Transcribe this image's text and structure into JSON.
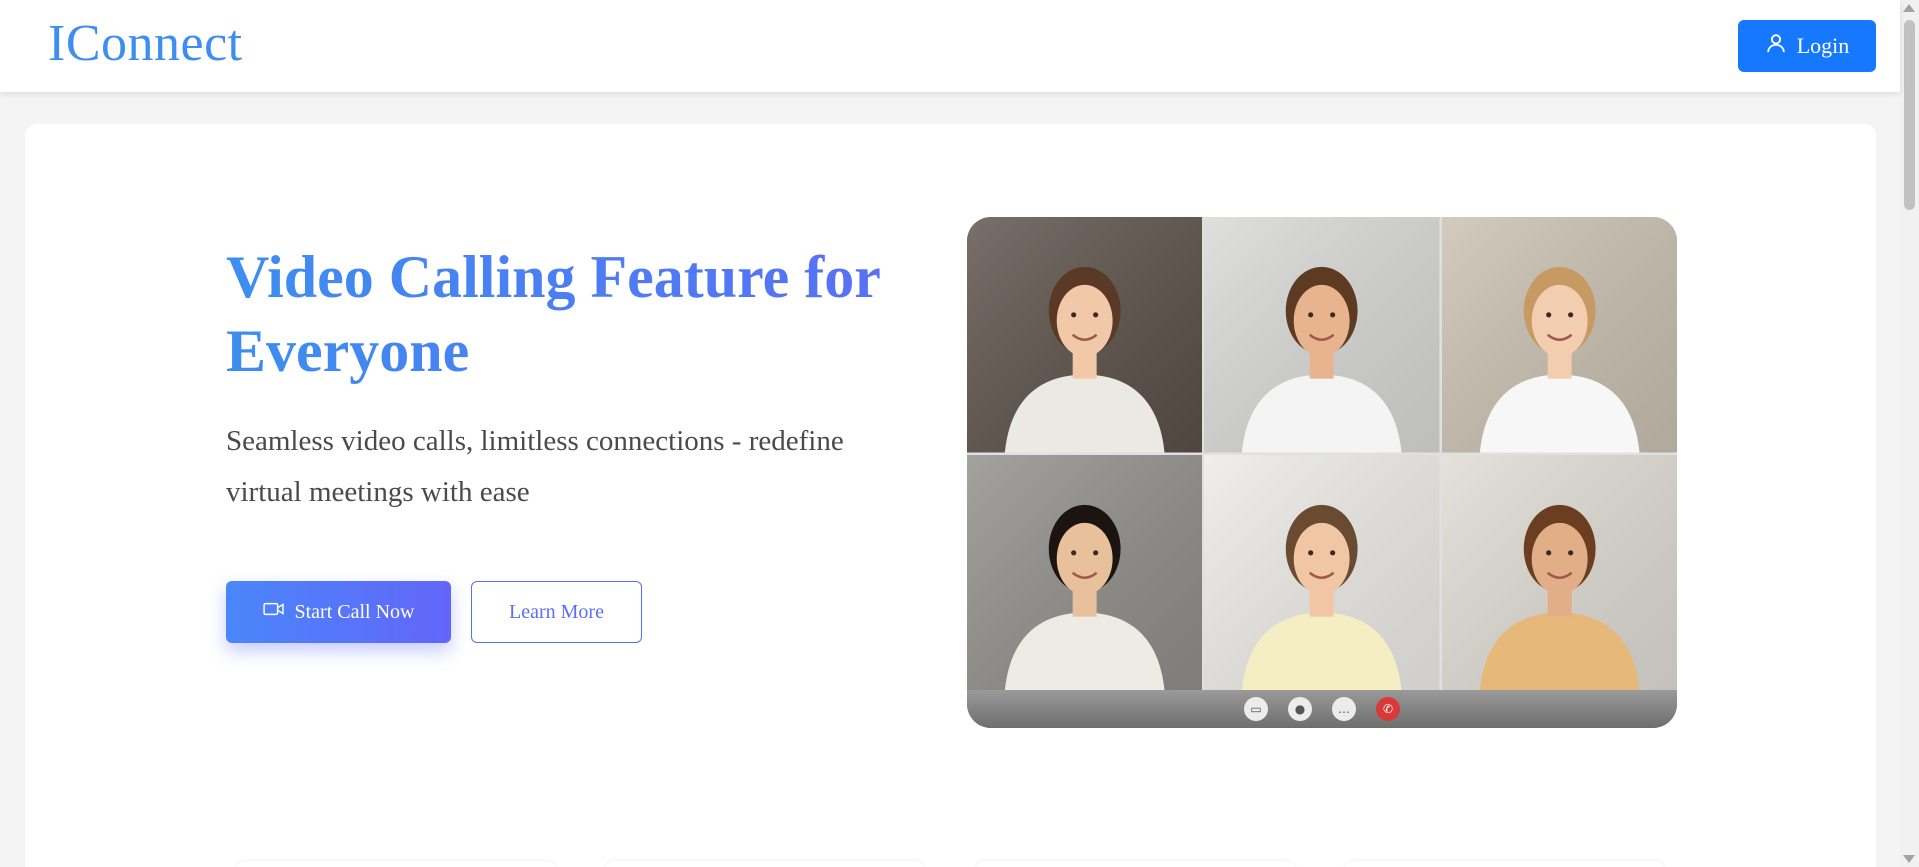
{
  "header": {
    "logo": "IConnect",
    "login_label": "Login"
  },
  "hero": {
    "title": "Video Calling Feature for Everyone",
    "subtitle": "Seamless video calls, limitless connections - redefine virtual meetings with ease",
    "start_label": "Start Call Now",
    "learn_label": "Learn More"
  },
  "video_call": {
    "participants": [
      {
        "id": "participant-1",
        "shirt": "#ece8e2",
        "bg": "#5a5048"
      },
      {
        "id": "participant-2",
        "shirt": "#f4f4f4",
        "bg": "#d8d8d6"
      },
      {
        "id": "participant-3",
        "shirt": "#f7f7f7",
        "bg": "#c9c0b0"
      },
      {
        "id": "participant-4",
        "shirt": "#ecebe4",
        "bg": "#8f8e8a"
      },
      {
        "id": "participant-5",
        "shirt": "#f5edc4",
        "bg": "#ecebe7"
      },
      {
        "id": "participant-6",
        "shirt": "#e6b97a",
        "bg": "#dfdbd4"
      }
    ],
    "controls": [
      "camera-icon",
      "microphone-icon",
      "chat-icon",
      "end-call-icon"
    ]
  },
  "colors": {
    "brand": "#3d8ef0",
    "accent": "#5b6ef5",
    "login_bg": "#1677ff",
    "end_call": "#d83a3a"
  }
}
